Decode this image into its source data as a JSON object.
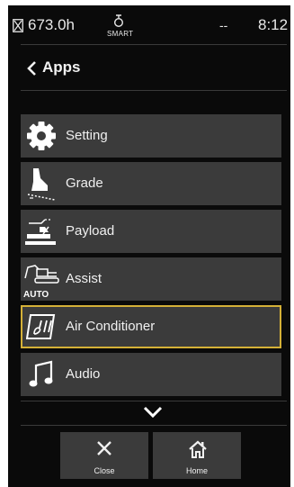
{
  "status_bar": {
    "hours": "673.0h",
    "smart_label": "SMART",
    "signal": "--",
    "time": "8:12"
  },
  "header": {
    "title": "Apps"
  },
  "apps": [
    {
      "label": "Setting",
      "icon": "gear-icon"
    },
    {
      "label": "Grade",
      "icon": "grade-icon"
    },
    {
      "label": "Payload",
      "icon": "payload-icon"
    },
    {
      "label": "Assist",
      "icon": "assist-icon",
      "badge": "AUTO"
    },
    {
      "label": "Air Conditioner",
      "icon": "air-conditioner-icon",
      "selected": true
    },
    {
      "label": "Audio",
      "icon": "music-note-icon"
    }
  ],
  "bottom_nav": {
    "close_label": "Close",
    "home_label": "Home"
  },
  "colors": {
    "screen_background": "#0a0a0a",
    "item_background": "#3b3b3b",
    "selection_border": "#d4b037",
    "text": "#f0f0f0"
  }
}
